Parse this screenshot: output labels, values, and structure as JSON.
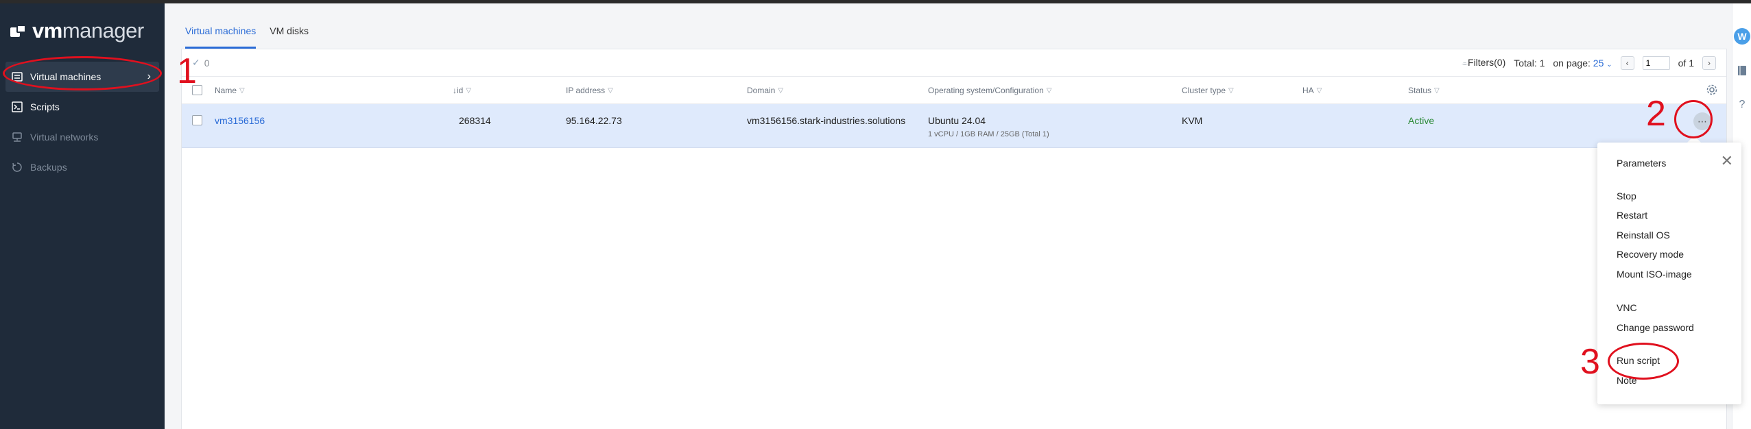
{
  "app": {
    "logo_bold": "vm",
    "logo_light": "manager"
  },
  "sidebar": {
    "items": [
      {
        "label": "Virtual machines",
        "state": "active"
      },
      {
        "label": "Scripts",
        "state": "normal"
      },
      {
        "label": "Virtual networks",
        "state": "disabled"
      },
      {
        "label": "Backups",
        "state": "disabled"
      }
    ]
  },
  "tabs": [
    {
      "label": "Virtual machines",
      "active": true
    },
    {
      "label": "VM disks",
      "active": false
    }
  ],
  "toolbar": {
    "selected_count": "0",
    "filters_label": "Filters(0)",
    "total_label": "Total: 1",
    "on_page_label": "on page:",
    "on_page_value": "25",
    "page_current": "1",
    "page_of": "of 1"
  },
  "table": {
    "columns": [
      {
        "label": "Name"
      },
      {
        "label": "↓id"
      },
      {
        "label": "IP address"
      },
      {
        "label": "Domain"
      },
      {
        "label": "Operating system/Configuration"
      },
      {
        "label": "Cluster type"
      },
      {
        "label": "HA"
      },
      {
        "label": "Status"
      }
    ],
    "rows": [
      {
        "name": "vm3156156",
        "id": "268314",
        "ip": "95.164.22.73",
        "domain": "vm3156156.stark-industries.solutions",
        "os": "Ubuntu 24.04",
        "config": "1 vCPU / 1GB RAM / 25GB (Total 1)",
        "cluster": "KVM",
        "ha": "",
        "status": "Active"
      }
    ]
  },
  "menu": {
    "title": "Parameters",
    "items": [
      "Stop",
      "Restart",
      "Reinstall OS",
      "Recovery mode",
      "Mount ISO-image",
      "VNC",
      "Change password",
      "Run script",
      "Note"
    ]
  },
  "rail": {
    "avatar_letter": "W",
    "help": "?"
  },
  "annotations": {
    "n1": "1",
    "n2": "2",
    "n3": "3",
    "color": "#e0101e"
  },
  "colors": {
    "accent": "#2a6bd6",
    "sidebar_bg": "#1f2b3a",
    "row_selected": "#dfeafc",
    "status_active": "#2e8b3a"
  }
}
